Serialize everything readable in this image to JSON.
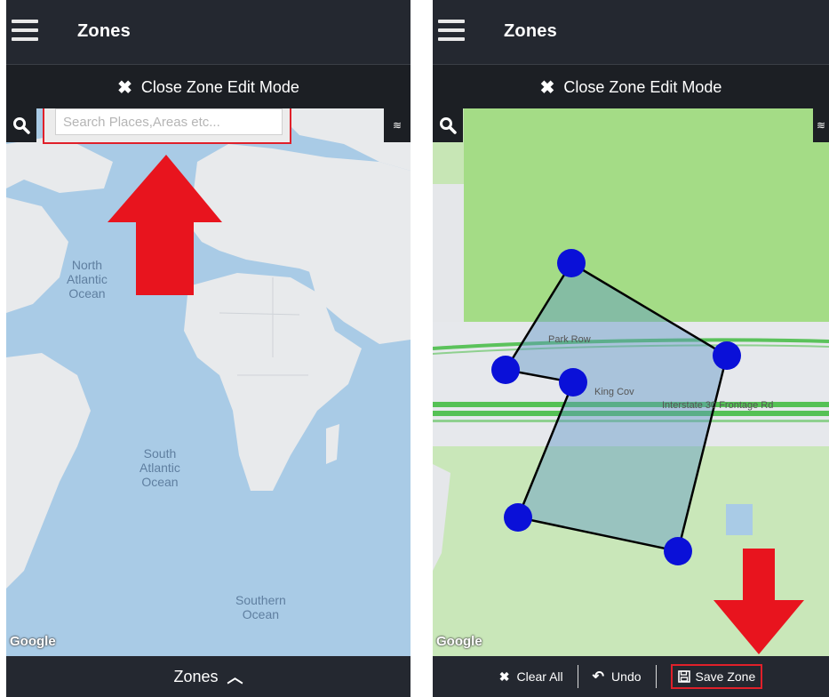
{
  "left": {
    "header": {
      "title": "Zones"
    },
    "edit_bar": {
      "icon": "close-x-icon",
      "label": "Close Zone Edit Mode"
    },
    "search": {
      "placeholder": "Search Places,Areas etc..."
    },
    "map_labels": {
      "north_atlantic": "North\nAtlantic\nOcean",
      "south_atlantic": "South\nAtlantic\nOcean",
      "southern": "Southern\nOcean"
    },
    "google": "Google",
    "bottom_bar": {
      "label": "Zones",
      "icon": "chevron-up-icon"
    }
  },
  "right": {
    "header": {
      "title": "Zones"
    },
    "edit_bar": {
      "icon": "close-x-icon",
      "label": "Close Zone Edit Mode"
    },
    "road_labels": {
      "park_row": "Park Row",
      "king": "King Cov",
      "interstate": "Interstate 30 Frontage Rd"
    },
    "google": "Google",
    "bottom_bar": {
      "clear_all": "Clear All",
      "undo": "Undo",
      "save_zone": "Save Zone"
    }
  },
  "colors": {
    "header_bg": "#242830",
    "annotation_red": "#e0202a",
    "vertex_blue": "#0a10d8",
    "ocean": "#a9cbe6",
    "land": "#e8eaec",
    "park_green": "#a4dc86"
  }
}
